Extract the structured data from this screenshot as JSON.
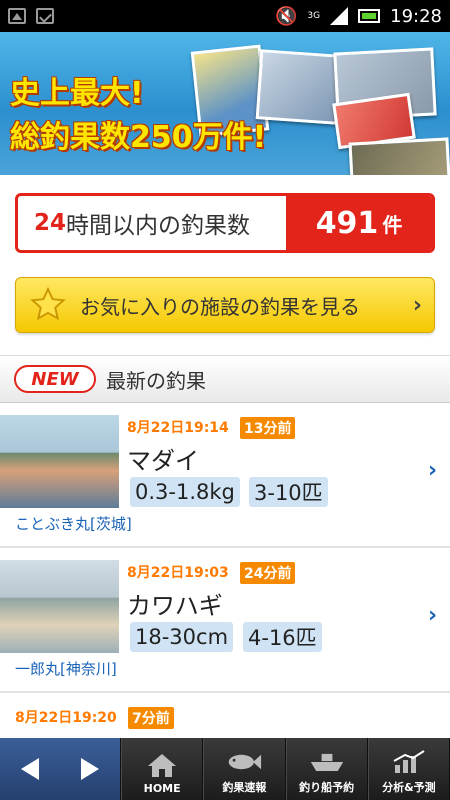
{
  "status_bar": {
    "time": "19:28",
    "network": "3G"
  },
  "banner": {
    "line1": "史上最大!",
    "line2": "総釣果数250万件!"
  },
  "count_box": {
    "label_hours": "24",
    "label_rest": "時間以内の釣果数",
    "value": "491",
    "unit": "件"
  },
  "favorites_button": {
    "label": "お気に入りの施設の釣果を見る",
    "chevron": "›"
  },
  "section": {
    "badge": "NEW",
    "title": "最新の釣果"
  },
  "catches": [
    {
      "time": "8月22日19:14",
      "ago": "13分前",
      "species": "マダイ",
      "size": "0.3-1.8kg",
      "count": "3-10匹",
      "boat": "ことぶき丸[茨城]"
    },
    {
      "time": "8月22日19:03",
      "ago": "24分前",
      "species": "カワハギ",
      "size": "18-30cm",
      "count": "4-16匹",
      "boat": "一郎丸[神奈川]"
    },
    {
      "time": "8月22日19:20",
      "ago": "7分前"
    }
  ],
  "bottom_nav": {
    "items": [
      {
        "label": "HOME",
        "icon": "home-icon"
      },
      {
        "label": "釣果速報",
        "icon": "fish-icon"
      },
      {
        "label": "釣り船予約",
        "icon": "boat-icon"
      },
      {
        "label": "分析&予測",
        "icon": "chart-icon"
      }
    ]
  },
  "colors": {
    "accent_red": "#e3241a",
    "orange": "#ff7a00",
    "link_blue": "#1a63b8",
    "chip_blue": "#cfe3f4",
    "star_yellow": "#f5c800"
  }
}
